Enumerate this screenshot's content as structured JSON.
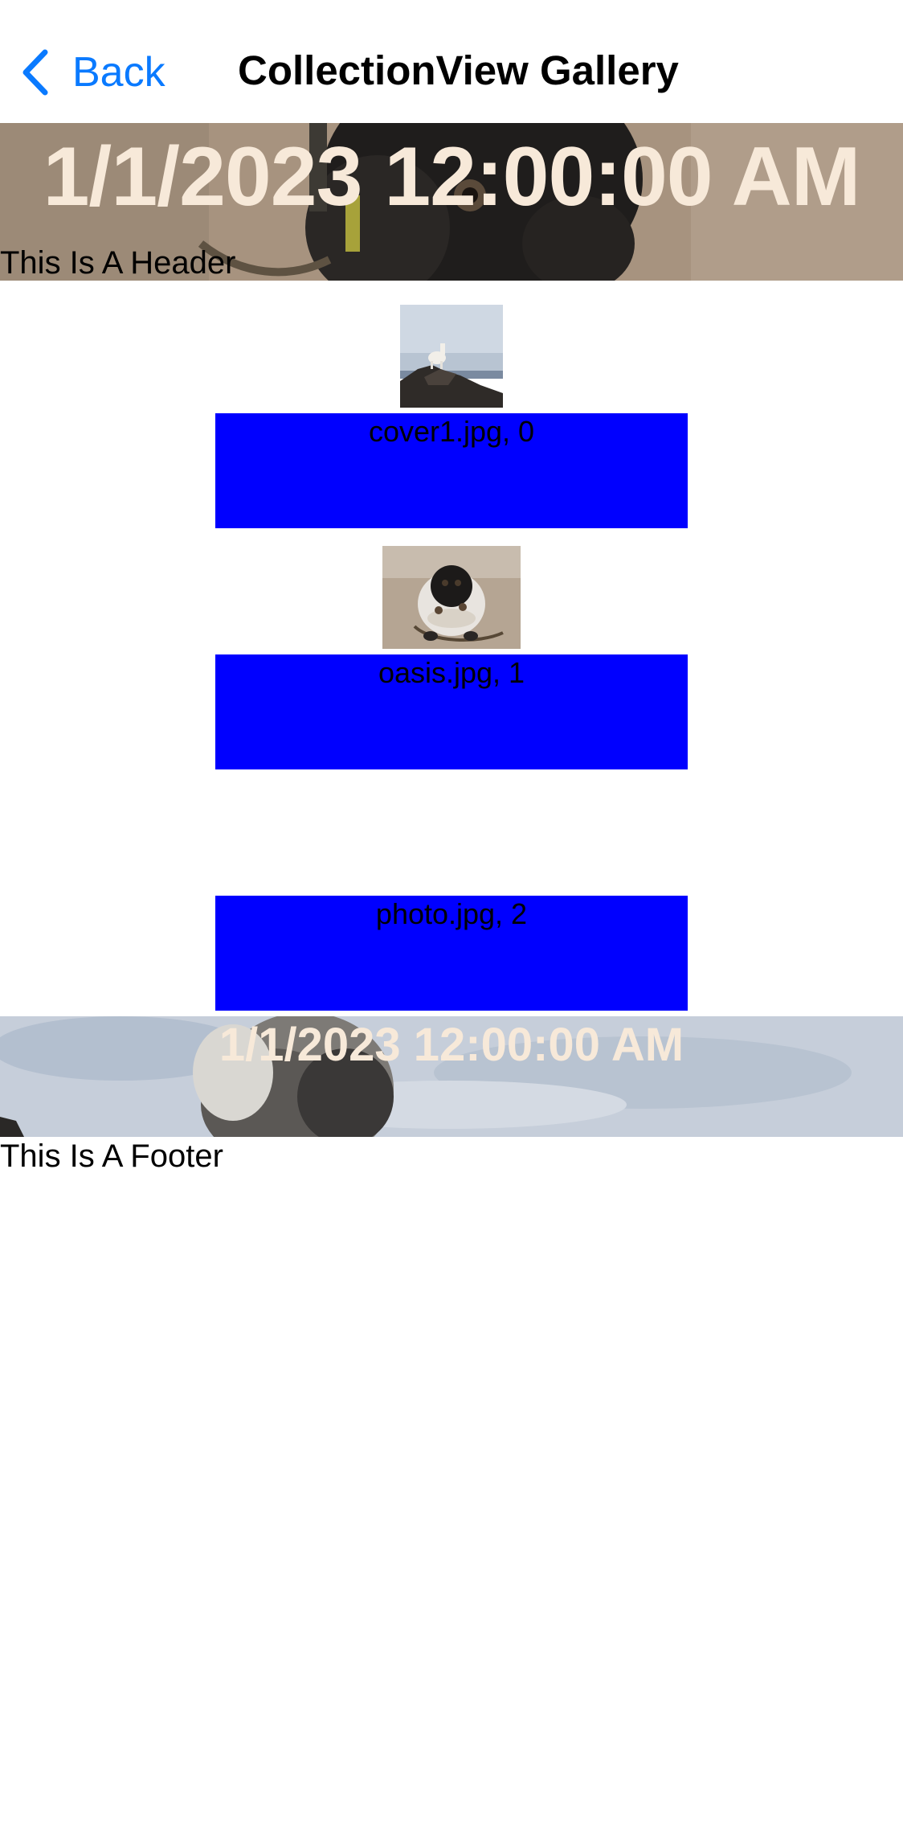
{
  "nav": {
    "back_label": "Back",
    "title": "CollectionView Gallery"
  },
  "header": {
    "date": "1/1/2023 12:00:00 AM",
    "label": "This Is A Header"
  },
  "items": [
    {
      "caption": "cover1.jpg, 0",
      "image": "mountain-goat-photo"
    },
    {
      "caption": "oasis.jpg, 1",
      "image": "pug-photo"
    },
    {
      "caption": "photo.jpg, 2",
      "image": ""
    }
  ],
  "footer": {
    "date": "1/1/2023 12:00:00 AM",
    "label": "This Is A Footer"
  },
  "colors": {
    "accent": "#0a7aff",
    "caption_background": "#0000ff",
    "banner_text": "#f7e9d9"
  }
}
